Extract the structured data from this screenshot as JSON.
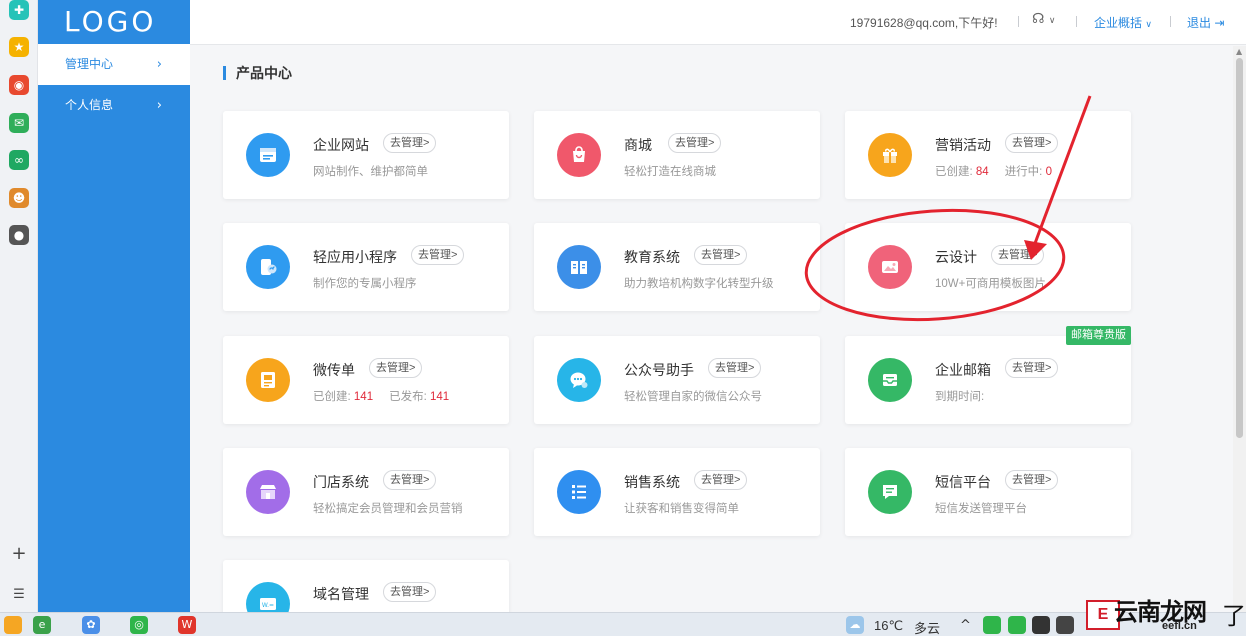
{
  "sidebar": {
    "logo": "LOGO",
    "items": [
      {
        "label": "管理中心"
      },
      {
        "label": "个人信息"
      }
    ]
  },
  "header": {
    "greeting": "19791628@qq.com,下午好!",
    "overview": "企业概括",
    "logout": "退出"
  },
  "main": {
    "section_title": "产品中心",
    "manage_label": "去管理>",
    "cards": [
      {
        "name": "企业网站",
        "desc": "网站制作、维护都简单",
        "color": "#2f9bf0"
      },
      {
        "name": "商城",
        "desc": "轻松打造在线商城",
        "color": "#f0586b"
      },
      {
        "name": "营销活动",
        "desc_label1": "已创建:",
        "desc_num1": "84",
        "desc_label2": "进行中:",
        "desc_num2": "0",
        "color": "#f7a51c"
      },
      {
        "name": "轻应用小程序",
        "desc": "制作您的专属小程序",
        "color": "#2f9bf0"
      },
      {
        "name": "教育系统",
        "desc": "助力教培机构数字化转型升级",
        "color": "#3c8fe8"
      },
      {
        "name": "云设计",
        "desc": "10W+可商用模板图片",
        "color": "#f0637a"
      },
      {
        "name": "微传单",
        "desc_label1": "已创建:",
        "desc_num1": "141",
        "desc_label2": "已发布:",
        "desc_num2": "141",
        "color": "#f7a51c"
      },
      {
        "name": "公众号助手",
        "desc": "轻松管理自家的微信公众号",
        "color": "#27b5e8"
      },
      {
        "name": "企业邮箱",
        "desc": "到期时间:",
        "badge": "邮箱尊贵版",
        "color": "#35b866"
      },
      {
        "name": "门店系统",
        "desc": "轻松搞定会员管理和会员营销",
        "color": "#a26de8"
      },
      {
        "name": "销售系统",
        "desc": "让获客和销售变得简单",
        "color": "#2f8ff0"
      },
      {
        "name": "短信平台",
        "desc": "短信发送管理平台",
        "color": "#35b866"
      },
      {
        "name": "域名管理",
        "desc": "",
        "color": "#27b5e8"
      }
    ]
  },
  "taskbar": {
    "temperature": "16℃",
    "weather": "多云"
  },
  "watermark": {
    "text": "云南龙网",
    "url": "eefl.cn",
    "tail": "了"
  },
  "colors": {
    "primary": "#2b8ae0",
    "danger": "#e02a3a",
    "annotation": "#e3232e"
  }
}
